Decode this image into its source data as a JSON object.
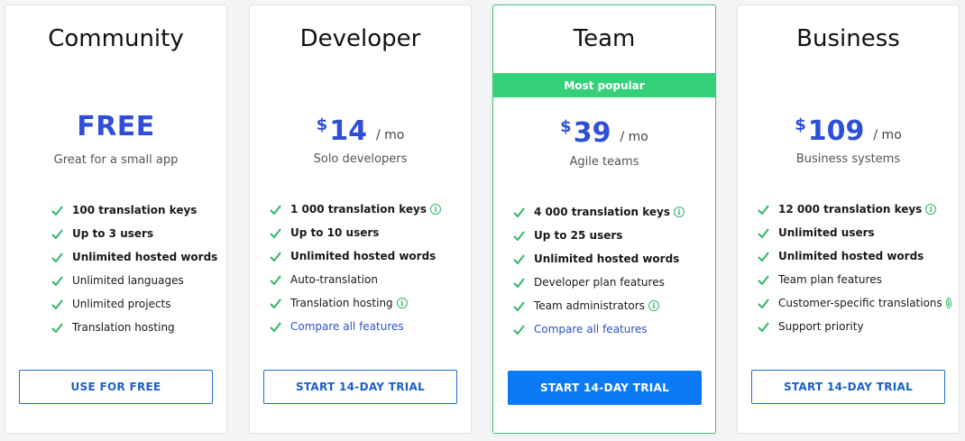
{
  "plans": [
    {
      "name": "Community",
      "price_text": "FREE",
      "subtitle": "Great for a small app",
      "features": [
        {
          "text": "100 translation keys",
          "bold": true
        },
        {
          "text": "Up to 3 users",
          "bold": true
        },
        {
          "text": "Unlimited hosted words",
          "bold": true
        },
        {
          "text": "Unlimited languages",
          "bold": false
        },
        {
          "text": "Unlimited projects",
          "bold": false
        },
        {
          "text": "Translation hosting",
          "bold": false
        }
      ],
      "cta": "USE FOR FREE"
    },
    {
      "name": "Developer",
      "currency": "$",
      "amount": "14",
      "period": "/ mo",
      "subtitle": "Solo developers",
      "features": [
        {
          "text": "1 000 translation keys",
          "bold": true,
          "info": "i"
        },
        {
          "text": "Up to 10 users",
          "bold": true
        },
        {
          "text": "Unlimited hosted words",
          "bold": true
        },
        {
          "text": "Auto-translation",
          "bold": false
        },
        {
          "text": "Translation hosting",
          "bold": false,
          "info": "i"
        },
        {
          "text": "Compare all features",
          "bold": false,
          "link": true
        }
      ],
      "cta": "START 14-DAY TRIAL"
    },
    {
      "name": "Team",
      "badge": "Most popular",
      "currency": "$",
      "amount": "39",
      "period": "/ mo",
      "subtitle": "Agile teams",
      "features": [
        {
          "text": "4 000 translation keys",
          "bold": true,
          "info": "i"
        },
        {
          "text": "Up to 25 users",
          "bold": true
        },
        {
          "text": "Unlimited hosted words",
          "bold": true
        },
        {
          "text": "Developer plan features",
          "bold": false
        },
        {
          "text": "Team administrators",
          "bold": false,
          "info": "i"
        },
        {
          "text": "Compare all features",
          "bold": false,
          "link": true
        }
      ],
      "cta": "START 14-DAY TRIAL"
    },
    {
      "name": "Business",
      "currency": "$",
      "amount": "109",
      "period": "/ mo",
      "subtitle": "Business systems",
      "features": [
        {
          "text": "12 000 translation keys",
          "bold": true,
          "info": "i"
        },
        {
          "text": "Unlimited users",
          "bold": true
        },
        {
          "text": "Unlimited hosted words",
          "bold": true
        },
        {
          "text": "Team plan features",
          "bold": false
        },
        {
          "text": "Customer-specific translations",
          "bold": false,
          "info": "i"
        },
        {
          "text": "Support priority",
          "bold": false
        }
      ],
      "cta": "START 14-DAY TRIAL"
    }
  ],
  "colors": {
    "accent_blue": "#2f4fd8",
    "cta_primary": "#0a7af7",
    "badge_green": "#35d07a",
    "check_green": "#2eb867"
  },
  "icons": {
    "check": "checkmark-icon",
    "info": "info-circle-icon"
  }
}
